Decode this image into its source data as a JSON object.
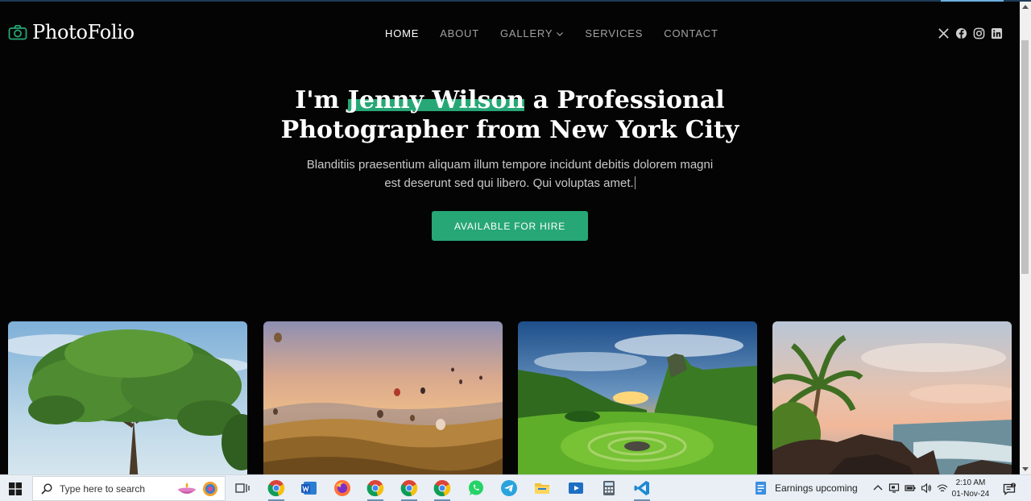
{
  "site": {
    "logo_text": "PhotoFolio",
    "nav": [
      {
        "label": "HOME",
        "active": true
      },
      {
        "label": "ABOUT"
      },
      {
        "label": "GALLERY",
        "has_dropdown": true
      },
      {
        "label": "SERVICES"
      },
      {
        "label": "CONTACT"
      }
    ],
    "socials": [
      "x-icon",
      "facebook-icon",
      "instagram-icon",
      "linkedin-icon"
    ]
  },
  "hero": {
    "title_prefix": "I'm ",
    "title_name": "Jenny Wilson",
    "title_suffix": " a Professional",
    "title_line2": "Photographer from New York City",
    "subtitle": "Blanditiis praesentium aliquam illum tempore incidunt debitis dolorem magni est deserunt sed qui libero. Qui voluptas amet.",
    "button_label": "AVAILABLE FOR HIRE"
  },
  "gallery": [
    {
      "icon": "tree-photo"
    },
    {
      "icon": "hot-air-balloons-photo"
    },
    {
      "icon": "green-valley-sunset-photo"
    },
    {
      "icon": "palm-beach-photo"
    }
  ],
  "taskbar": {
    "search_placeholder": "Type here to search",
    "weather_text": "Earnings upcoming",
    "time": "2:10 AM",
    "date": "01-Nov-24"
  },
  "colors": {
    "accent": "#27a776",
    "background": "#040404",
    "taskbar": "#e9eff5"
  }
}
